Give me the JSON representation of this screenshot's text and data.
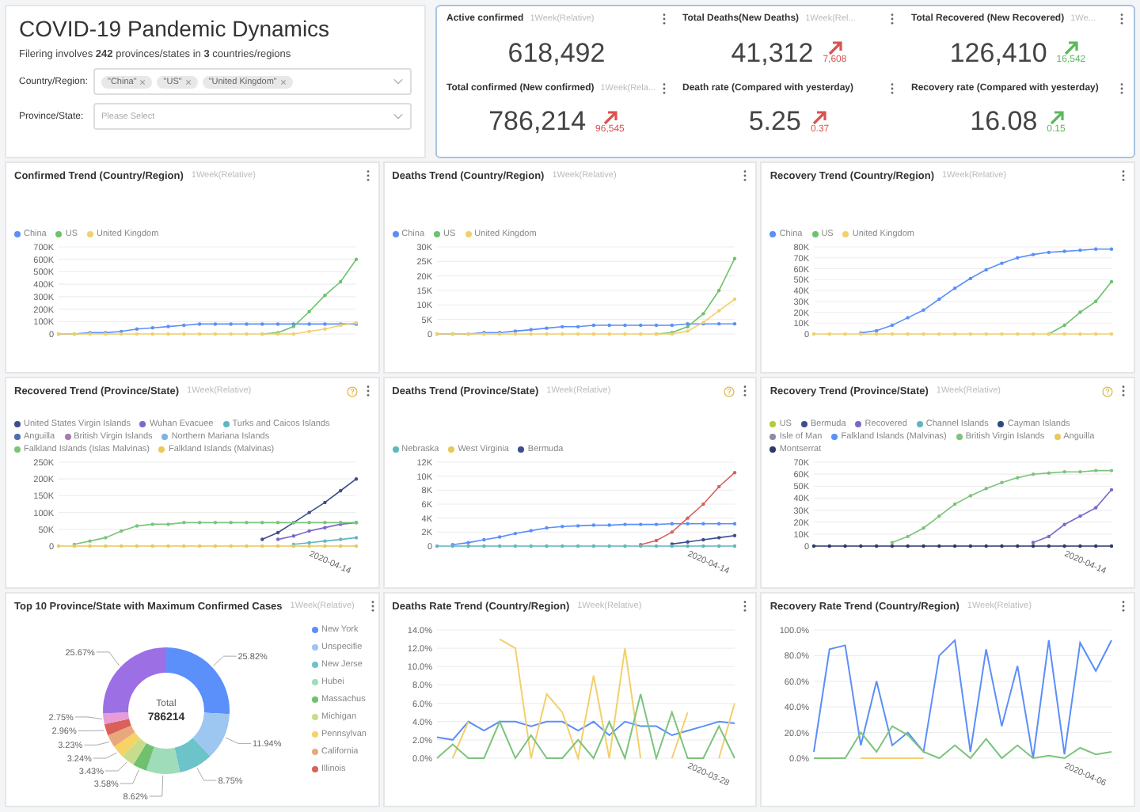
{
  "header": {
    "title": "COVID-19 Pandemic Dynamics",
    "summary": "Filering involves **242** provinces/states in **3** countries/regions",
    "filters": [
      {
        "label": "Country/Region:",
        "tags": [
          "\"China\"",
          "\"US\"",
          "\"United Kingdom\""
        ]
      },
      {
        "label": "Province/State:",
        "placeholder": "Please Select"
      }
    ]
  },
  "stats": [
    {
      "title": "Active confirmed",
      "subtitle": "1Week(Relative)",
      "value": "618,492"
    },
    {
      "title": "Total Deaths(New Deaths)",
      "subtitle": "1Week(Rel...",
      "value": "41,312",
      "change": "7,608",
      "color": "#d9534f"
    },
    {
      "title": "Total Recovered (New Recovered)",
      "subtitle": "1We...",
      "value": "126,410",
      "change": "16,542",
      "color": "#5cb85c"
    },
    {
      "title": "Total confirmed (New confirmed)",
      "subtitle": "1Week(Rela...",
      "value": "786,214",
      "change": "96,545",
      "color": "#d9534f"
    },
    {
      "title": "Death rate (Compared with yesterday)",
      "value": "5.25",
      "change": "0.37",
      "color": "#d9534f"
    },
    {
      "title": "Recovery rate (Compared with yesterday)",
      "value": "16.08",
      "change": "0.15",
      "color": "#5cb85c"
    }
  ],
  "charts": [
    {
      "kind": "trend",
      "title": "Confirmed Trend (Country/Region)",
      "subtitle": "1Week(Relative)",
      "legend": [
        {
          "name": "China",
          "color": "#5b8ff9"
        },
        {
          "name": "US",
          "color": "#6cc36c"
        },
        {
          "name": "United Kingdom",
          "color": "#f2d06b"
        }
      ],
      "chart_data": {
        "type": "line",
        "grid": true,
        "ylim": [
          0,
          700000
        ],
        "yticks": [
          {
            "value": 0,
            "label": "0"
          },
          {
            "value": 100000,
            "label": "100K"
          },
          {
            "value": 200000,
            "label": "200K"
          },
          {
            "value": 300000,
            "label": "300K"
          },
          {
            "value": 400000,
            "label": "400K"
          },
          {
            "value": 500000,
            "label": "500K"
          },
          {
            "value": 600000,
            "label": "600K"
          },
          {
            "value": 700000,
            "label": "700K"
          }
        ],
        "series": [
          {
            "color": "#5b8ff9",
            "values": [
              0,
              0,
              10000,
              10000,
              20000,
              40000,
              50000,
              60000,
              70000,
              80000,
              80000,
              80000,
              80000,
              80000,
              80000,
              80000,
              80000,
              80000,
              80000,
              80000
            ]
          },
          {
            "color": "#6cc36c",
            "values": [
              null,
              null,
              null,
              null,
              null,
              null,
              null,
              null,
              null,
              null,
              null,
              null,
              null,
              0,
              10000,
              60000,
              180000,
              310000,
              420000,
              600000
            ]
          },
          {
            "color": "#f2d06b",
            "values": [
              0,
              0,
              0,
              0,
              0,
              0,
              0,
              0,
              0,
              0,
              0,
              0,
              0,
              0,
              0,
              0,
              20000,
              40000,
              70000,
              90000
            ]
          }
        ]
      }
    },
    {
      "kind": "trend",
      "title": "Deaths Trend (Country/Region)",
      "subtitle": "1Week(Relative)",
      "legend": [
        {
          "name": "China",
          "color": "#5b8ff9"
        },
        {
          "name": "US",
          "color": "#6cc36c"
        },
        {
          "name": "United Kingdom",
          "color": "#f2d06b"
        }
      ],
      "chart_data": {
        "type": "line",
        "grid": true,
        "ylim": [
          0,
          30000
        ],
        "yticks": [
          {
            "value": 0,
            "label": "0"
          },
          {
            "value": 5000,
            "label": "5K"
          },
          {
            "value": 10000,
            "label": "10K"
          },
          {
            "value": 15000,
            "label": "15K"
          },
          {
            "value": 20000,
            "label": "20K"
          },
          {
            "value": 25000,
            "label": "25K"
          },
          {
            "value": 30000,
            "label": "30K"
          }
        ],
        "series": [
          {
            "color": "#5b8ff9",
            "values": [
              0,
              0,
              0,
              500,
              500,
              1000,
              1500,
              2000,
              2500,
              2500,
              3000,
              3000,
              3000,
              3000,
              3000,
              3000,
              3500,
              3500,
              3500,
              3500
            ]
          },
          {
            "color": "#6cc36c",
            "values": [
              null,
              null,
              null,
              null,
              null,
              null,
              null,
              null,
              null,
              null,
              null,
              null,
              null,
              null,
              0,
              500,
              2500,
              7000,
              15000,
              26000
            ]
          },
          {
            "color": "#f2d06b",
            "values": [
              0,
              0,
              0,
              0,
              0,
              0,
              0,
              0,
              0,
              0,
              0,
              0,
              0,
              0,
              0,
              0,
              1000,
              4000,
              8000,
              12000
            ]
          }
        ]
      }
    },
    {
      "kind": "trend",
      "title": "Recovery Trend (Country/Region)",
      "subtitle": "1Week(Relative)",
      "legend": [
        {
          "name": "China",
          "color": "#5b8ff9"
        },
        {
          "name": "US",
          "color": "#6cc36c"
        },
        {
          "name": "United Kingdom",
          "color": "#f2d06b"
        }
      ],
      "chart_data": {
        "type": "line",
        "grid": true,
        "ylim": [
          0,
          80000
        ],
        "yticks": [
          {
            "value": 0,
            "label": "0"
          },
          {
            "value": 10000,
            "label": "10K"
          },
          {
            "value": 20000,
            "label": "20K"
          },
          {
            "value": 30000,
            "label": "30K"
          },
          {
            "value": 40000,
            "label": "40K"
          },
          {
            "value": 50000,
            "label": "50K"
          },
          {
            "value": 60000,
            "label": "60K"
          },
          {
            "value": 70000,
            "label": "70K"
          },
          {
            "value": 80000,
            "label": "80K"
          }
        ],
        "series": [
          {
            "color": "#5b8ff9",
            "values": [
              null,
              null,
              null,
              1000,
              3000,
              8000,
              15000,
              22000,
              32000,
              42000,
              51000,
              59000,
              65000,
              70000,
              73000,
              75000,
              76000,
              77000,
              78000,
              78000
            ]
          },
          {
            "color": "#6cc36c",
            "values": [
              null,
              null,
              null,
              null,
              null,
              null,
              null,
              null,
              null,
              null,
              null,
              null,
              null,
              null,
              null,
              0,
              8000,
              20000,
              30000,
              48000
            ]
          },
          {
            "color": "#f2d06b",
            "values": [
              0,
              0,
              0,
              0,
              0,
              0,
              0,
              0,
              0,
              0,
              0,
              0,
              0,
              0,
              0,
              0,
              0,
              0,
              0,
              0
            ]
          }
        ]
      }
    },
    {
      "kind": "trend",
      "title": "Recovered Trend (Province/State)",
      "subtitle": "1Week(Relative)",
      "help_icon": true,
      "axis_end_label": "2020-04-14",
      "legend": [
        {
          "name": "United States Virgin Islands",
          "color": "#3d4e8c"
        },
        {
          "name": "Wuhan Evacuee",
          "color": "#7b68c8"
        },
        {
          "name": "Turks and Caicos Islands",
          "color": "#5fb7c0"
        },
        {
          "name": "Anguilla",
          "color": "#4a6fb5"
        },
        {
          "name": "British Virgin Islands",
          "color": "#a77cb0"
        },
        {
          "name": "Northern Mariana Islands",
          "color": "#7fb2e5"
        },
        {
          "name": "Falkland Islands (Islas Malvinas)",
          "color": "#7cc47c"
        },
        {
          "name": "Falkland Islands (Malvinas)",
          "color": "#e8c95a"
        }
      ],
      "chart_data": {
        "type": "line",
        "grid": true,
        "ylim": [
          0,
          250000
        ],
        "yticks": [
          {
            "value": 0,
            "label": "0"
          },
          {
            "value": 50000,
            "label": "50K"
          },
          {
            "value": 100000,
            "label": "100K"
          },
          {
            "value": 150000,
            "label": "150K"
          },
          {
            "value": 200000,
            "label": "200K"
          },
          {
            "value": 250000,
            "label": "250K"
          }
        ],
        "series": [
          {
            "color": "#3d4e8c",
            "values": [
              null,
              null,
              null,
              null,
              null,
              null,
              null,
              null,
              null,
              null,
              null,
              null,
              null,
              20000,
              40000,
              70000,
              100000,
              130000,
              165000,
              200000
            ]
          },
          {
            "color": "#7b68c8",
            "values": [
              null,
              null,
              null,
              null,
              null,
              null,
              null,
              null,
              null,
              null,
              null,
              null,
              null,
              null,
              20000,
              30000,
              45000,
              55000,
              65000,
              70000
            ]
          },
          {
            "color": "#5fb7c0",
            "values": [
              null,
              null,
              null,
              null,
              null,
              null,
              null,
              null,
              null,
              null,
              null,
              null,
              null,
              null,
              null,
              5000,
              10000,
              15000,
              20000,
              25000
            ]
          },
          {
            "color": "#7cc47c",
            "values": [
              null,
              5000,
              15000,
              25000,
              45000,
              60000,
              65000,
              65000,
              70000,
              70000,
              70000,
              70000,
              70000,
              70000,
              70000,
              70000,
              70000,
              70000,
              70000,
              70000
            ]
          },
          {
            "color": "#e8c95a",
            "values": [
              0,
              0,
              0,
              0,
              0,
              0,
              0,
              0,
              0,
              0,
              0,
              0,
              0,
              0,
              0,
              0,
              0,
              0,
              0,
              0
            ]
          }
        ]
      }
    },
    {
      "kind": "trend",
      "title": "Deaths Trend (Province/State)",
      "subtitle": "1Week(Relative)",
      "help_icon": true,
      "axis_end_label": "2020-04-14",
      "legend": [
        {
          "name": "Nebraska",
          "color": "#5fb7c0"
        },
        {
          "name": "West Virginia",
          "color": "#e8c95a"
        },
        {
          "name": "Bermuda",
          "color": "#3d4e8c"
        }
      ],
      "chart_data": {
        "type": "line",
        "grid": true,
        "ylim": [
          0,
          12000
        ],
        "yticks": [
          {
            "value": 0,
            "label": "0"
          },
          {
            "value": 2000,
            "label": "2K"
          },
          {
            "value": 4000,
            "label": "4K"
          },
          {
            "value": 6000,
            "label": "6K"
          },
          {
            "value": 8000,
            "label": "8K"
          },
          {
            "value": 10000,
            "label": "10K"
          },
          {
            "value": 12000,
            "label": "12K"
          }
        ],
        "series": [
          {
            "color": "#3d4e8c",
            "values": [
              null,
              null,
              null,
              null,
              null,
              null,
              null,
              null,
              null,
              null,
              null,
              null,
              null,
              null,
              null,
              300,
              600,
              900,
              1200,
              1500
            ]
          },
          {
            "color": "#d9615a",
            "values": [
              null,
              null,
              null,
              null,
              null,
              null,
              null,
              null,
              null,
              null,
              null,
              null,
              null,
              200,
              800,
              2000,
              4000,
              6000,
              8500,
              10500
            ]
          },
          {
            "color": "#5b8ff9",
            "values": [
              null,
              200,
              500,
              900,
              1300,
              1800,
              2200,
              2600,
              2800,
              2900,
              3000,
              3000,
              3100,
              3100,
              3100,
              3200,
              3200,
              3200,
              3200,
              3200
            ]
          },
          {
            "color": "#5fb7c0",
            "values": [
              0,
              0,
              0,
              0,
              0,
              0,
              0,
              0,
              0,
              0,
              0,
              0,
              0,
              0,
              0,
              0,
              0,
              0,
              0,
              0
            ]
          }
        ]
      }
    },
    {
      "kind": "trend",
      "title": "Recovery Trend (Province/State)",
      "subtitle": "1Week(Relative)",
      "help_icon": true,
      "axis_end_label": "2020-04-14",
      "legend": [
        {
          "name": "US",
          "color": "#b5c93a"
        },
        {
          "name": "Bermuda",
          "color": "#3d4e8c"
        },
        {
          "name": "Recovered",
          "color": "#7b68c8"
        },
        {
          "name": "Channel Islands",
          "color": "#5fb7c0"
        },
        {
          "name": "Cayman Islands",
          "color": "#2f4a7a"
        },
        {
          "name": "Isle of Man",
          "color": "#8c8ca6"
        },
        {
          "name": "Falkland Islands (Malvinas)",
          "color": "#5b8ff9"
        },
        {
          "name": "British Virgin Islands",
          "color": "#7cc47c"
        },
        {
          "name": "Anguilla",
          "color": "#e8c95a"
        },
        {
          "name": "Montserrat",
          "color": "#2b3a67"
        }
      ],
      "chart_data": {
        "type": "line",
        "grid": true,
        "ylim": [
          0,
          70000
        ],
        "yticks": [
          {
            "value": 0,
            "label": "0"
          },
          {
            "value": 10000,
            "label": "10K"
          },
          {
            "value": 20000,
            "label": "20K"
          },
          {
            "value": 30000,
            "label": "30K"
          },
          {
            "value": 40000,
            "label": "40K"
          },
          {
            "value": 50000,
            "label": "50K"
          },
          {
            "value": 60000,
            "label": "60K"
          },
          {
            "value": 70000,
            "label": "70K"
          }
        ],
        "series": [
          {
            "color": "#7cc47c",
            "values": [
              null,
              null,
              null,
              null,
              null,
              3000,
              8000,
              15000,
              25000,
              35000,
              42000,
              48000,
              53000,
              57000,
              60000,
              61000,
              62000,
              62000,
              63000,
              63000
            ]
          },
          {
            "color": "#7b68c8",
            "values": [
              null,
              null,
              null,
              null,
              null,
              null,
              null,
              null,
              null,
              null,
              null,
              null,
              null,
              null,
              3000,
              8000,
              18000,
              25000,
              32000,
              47000
            ]
          },
          {
            "color": "#2b3a67",
            "values": [
              0,
              0,
              0,
              0,
              0,
              0,
              0,
              0,
              0,
              0,
              0,
              0,
              0,
              0,
              0,
              0,
              0,
              0,
              0,
              0
            ]
          }
        ]
      }
    },
    {
      "title": "Top 10 Province/State with Maximum Confirmed Cases",
      "subtitle": "1Week(Relative)",
      "center_label": "Total",
      "center_value": "786214",
      "legend": [
        {
          "name": "New York",
          "color": "#5b8ff9"
        },
        {
          "name": "Unspecifie",
          "color": "#9dc6f0"
        },
        {
          "name": "New Jerse",
          "color": "#6cc3c9"
        },
        {
          "name": "Hubei",
          "color": "#9fdcb9"
        },
        {
          "name": "Massachus",
          "color": "#6fc16f"
        },
        {
          "name": "Michigan",
          "color": "#c8dd8c"
        },
        {
          "name": "Pennsylvan",
          "color": "#f6d365"
        },
        {
          "name": "California",
          "color": "#e8a87c"
        },
        {
          "name": "Illinois",
          "color": "#d9615a"
        }
      ],
      "chart_data": {
        "type": "donut",
        "values": [
          25.82,
          11.94,
          8.75,
          8.62,
          3.58,
          3.43,
          3.24,
          3.23,
          2.96,
          2.75,
          25.67
        ],
        "value_labels": [
          "25.82%",
          "11.94%",
          "8.75%",
          "8.62%",
          "3.58%",
          "3.43%",
          "3.24%",
          "3.23%",
          "2.96%",
          "2.75%",
          "25.67%"
        ],
        "colors": [
          "#5b8ff9",
          "#9dc6f0",
          "#6cc3c9",
          "#9fdcb9",
          "#6fc16f",
          "#c8dd8c",
          "#f6d365",
          "#e8a87c",
          "#d9615a",
          "#e89bd6",
          "#9c6fe4"
        ]
      }
    },
    {
      "kind": "rate",
      "title": "Deaths Rate Trend (Country/Region)",
      "subtitle": "1Week(Relative)",
      "axis_end_label": "2020-03-28",
      "chart_data": {
        "type": "line",
        "grid": true,
        "ylim": [
          0,
          14
        ],
        "yticks": [
          {
            "value": 0,
            "label": "0.0%"
          },
          {
            "value": 2,
            "label": "2.0%"
          },
          {
            "value": 4,
            "label": "4.0%"
          },
          {
            "value": 6,
            "label": "6.0%"
          },
          {
            "value": 8,
            "label": "8.0%"
          },
          {
            "value": 10,
            "label": "10.0%"
          },
          {
            "value": 12,
            "label": "12.0%"
          },
          {
            "value": 14,
            "label": "14.0%"
          }
        ],
        "series": [
          {
            "color": "#5b8ff9",
            "values": [
              2.3,
              2,
              4,
              3,
              4,
              4,
              3.5,
              4,
              4,
              3,
              4,
              2.5,
              4,
              3.5,
              3.5,
              2.5,
              3,
              3.5,
              4,
              3.8
            ]
          },
          {
            "color": "#f2d06b",
            "values": [
              null,
              0,
              4,
              null,
              13,
              12,
              0,
              7,
              5,
              0,
              9,
              0,
              12,
              0,
              null,
              0,
              5,
              null,
              0,
              6
            ]
          },
          {
            "color": "#7cc47c",
            "values": [
              0,
              1.5,
              0,
              0,
              4,
              0,
              2.5,
              0,
              0,
              2,
              0,
              4,
              0,
              7,
              0,
              5,
              0,
              0,
              3.5,
              0
            ]
          }
        ]
      }
    },
    {
      "kind": "rate",
      "title": "Recovery Rate Trend (Country/Region)",
      "subtitle": "1Week(Relative)",
      "axis_end_label": "2020-04-06",
      "chart_data": {
        "type": "line",
        "grid": true,
        "ylim": [
          0,
          100
        ],
        "yticks": [
          {
            "value": 0,
            "label": "0.0%"
          },
          {
            "value": 20,
            "label": "20.0%"
          },
          {
            "value": 40,
            "label": "40.0%"
          },
          {
            "value": 60,
            "label": "60.0%"
          },
          {
            "value": 80,
            "label": "80.0%"
          },
          {
            "value": 100,
            "label": "100.0%"
          }
        ],
        "series": [
          {
            "color": "#f2d06b",
            "values": [
              null,
              null,
              null,
              0,
              0,
              0,
              0,
              0,
              null,
              null,
              null,
              null,
              null,
              null,
              null,
              null,
              null,
              null,
              null,
              null
            ]
          },
          {
            "color": "#5b8ff9",
            "values": [
              5,
              85,
              88,
              10,
              60,
              10,
              20,
              5,
              80,
              92,
              5,
              85,
              25,
              72,
              0,
              92,
              3,
              90,
              68,
              92
            ]
          },
          {
            "color": "#7cc47c",
            "values": [
              0,
              0,
              0,
              20,
              5,
              25,
              18,
              5,
              0,
              10,
              0,
              15,
              0,
              10,
              0,
              2,
              0,
              8,
              3,
              5
            ]
          }
        ]
      }
    }
  ]
}
